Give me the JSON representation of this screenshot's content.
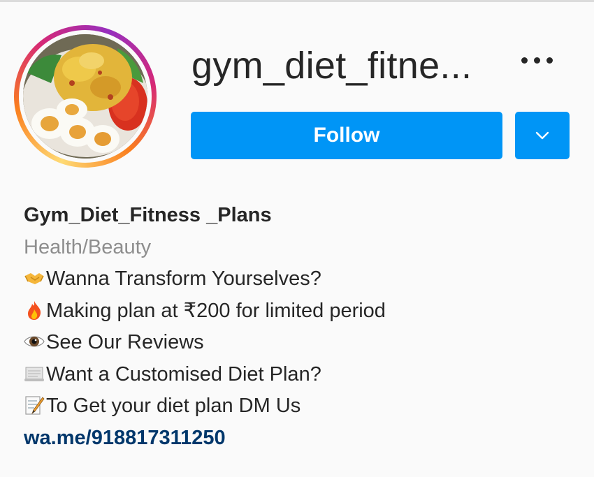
{
  "profile": {
    "username": "gym_diet_fitne...",
    "follow_label": "Follow",
    "full_name": "Gym_Diet_Fitness _Plans",
    "category": "Health/Beauty",
    "bio_lines": [
      {
        "icon": "handshake-icon",
        "text": "Wanna Transform Yourselves?"
      },
      {
        "icon": "fire-icon",
        "text": "Making plan at ₹200 for limited period"
      },
      {
        "icon": "eye-icon",
        "text": "See Our Reviews"
      },
      {
        "icon": "scroll-icon",
        "text": "Want a Customised Diet Plan?"
      },
      {
        "icon": "memo-icon",
        "text": "To Get your diet plan DM Us"
      }
    ],
    "link": "wa.me/918817311250"
  },
  "colors": {
    "follow_button": "#0095f6",
    "link": "#00376b",
    "category": "#8e8e8e",
    "background": "#fafafa"
  },
  "icons": {
    "more": "more-options-icon",
    "dropdown": "chevron-down-icon",
    "avatar": "profile-picture"
  }
}
